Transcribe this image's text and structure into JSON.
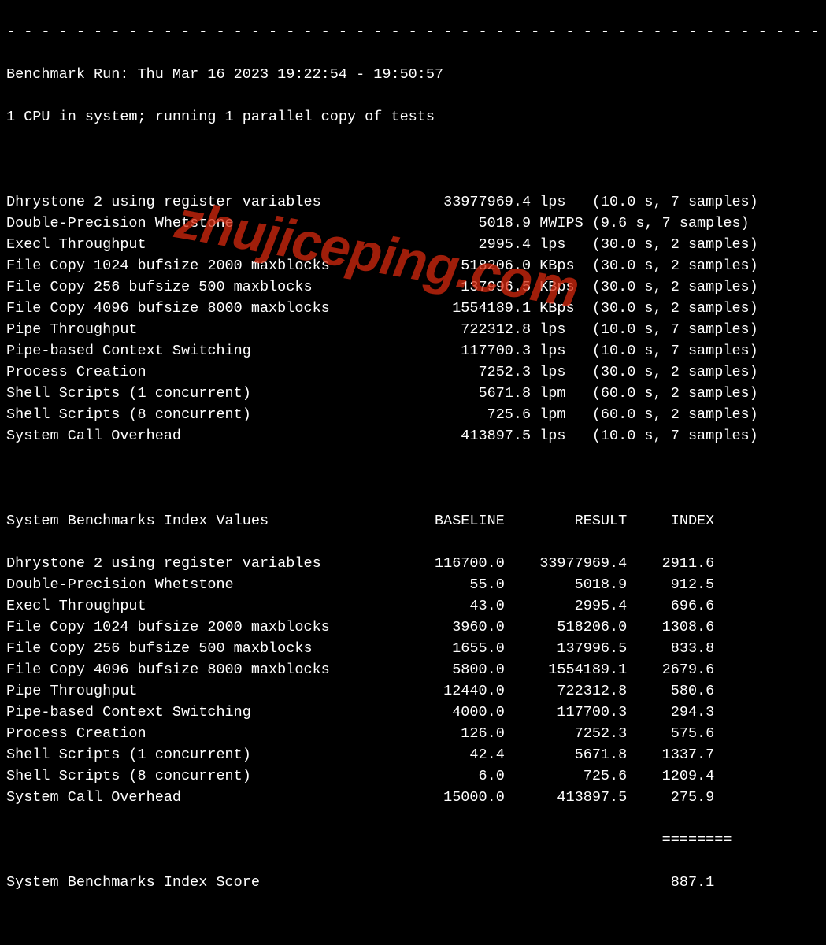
{
  "dashline": "- - - - - - - - - - - - - - - - - - - - - - - - - - - - - - - - - - - - - - - - - - - - - - -",
  "header1": "Benchmark Run: Thu Mar 16 2023 19:22:54 - 19:50:57",
  "header2": "1 CPU in system; running 1 parallel copy of tests",
  "results": [
    {
      "name": "Dhrystone 2 using register variables",
      "value": "33977969.4",
      "unit": "lps",
      "timing": "(10.0 s, 7 samples)"
    },
    {
      "name": "Double-Precision Whetstone",
      "value": "5018.9",
      "unit": "MWIPS",
      "timing": "(9.6 s, 7 samples)"
    },
    {
      "name": "Execl Throughput",
      "value": "2995.4",
      "unit": "lps",
      "timing": "(30.0 s, 2 samples)"
    },
    {
      "name": "File Copy 1024 bufsize 2000 maxblocks",
      "value": "518206.0",
      "unit": "KBps",
      "timing": "(30.0 s, 2 samples)"
    },
    {
      "name": "File Copy 256 bufsize 500 maxblocks",
      "value": "137996.5",
      "unit": "KBps",
      "timing": "(30.0 s, 2 samples)"
    },
    {
      "name": "File Copy 4096 bufsize 8000 maxblocks",
      "value": "1554189.1",
      "unit": "KBps",
      "timing": "(30.0 s, 2 samples)"
    },
    {
      "name": "Pipe Throughput",
      "value": "722312.8",
      "unit": "lps",
      "timing": "(10.0 s, 7 samples)"
    },
    {
      "name": "Pipe-based Context Switching",
      "value": "117700.3",
      "unit": "lps",
      "timing": "(10.0 s, 7 samples)"
    },
    {
      "name": "Process Creation",
      "value": "7252.3",
      "unit": "lps",
      "timing": "(30.0 s, 2 samples)"
    },
    {
      "name": "Shell Scripts (1 concurrent)",
      "value": "5671.8",
      "unit": "lpm",
      "timing": "(60.0 s, 2 samples)"
    },
    {
      "name": "Shell Scripts (8 concurrent)",
      "value": "725.6",
      "unit": "lpm",
      "timing": "(60.0 s, 2 samples)"
    },
    {
      "name": "System Call Overhead",
      "value": "413897.5",
      "unit": "lps",
      "timing": "(10.0 s, 7 samples)"
    }
  ],
  "index_header": {
    "title": "System Benchmarks Index Values",
    "c1": "BASELINE",
    "c2": "RESULT",
    "c3": "INDEX"
  },
  "index_rows": [
    {
      "name": "Dhrystone 2 using register variables",
      "baseline": "116700.0",
      "result": "33977969.4",
      "index": "2911.6"
    },
    {
      "name": "Double-Precision Whetstone",
      "baseline": "55.0",
      "result": "5018.9",
      "index": "912.5"
    },
    {
      "name": "Execl Throughput",
      "baseline": "43.0",
      "result": "2995.4",
      "index": "696.6"
    },
    {
      "name": "File Copy 1024 bufsize 2000 maxblocks",
      "baseline": "3960.0",
      "result": "518206.0",
      "index": "1308.6"
    },
    {
      "name": "File Copy 256 bufsize 500 maxblocks",
      "baseline": "1655.0",
      "result": "137996.5",
      "index": "833.8"
    },
    {
      "name": "File Copy 4096 bufsize 8000 maxblocks",
      "baseline": "5800.0",
      "result": "1554189.1",
      "index": "2679.6"
    },
    {
      "name": "Pipe Throughput",
      "baseline": "12440.0",
      "result": "722312.8",
      "index": "580.6"
    },
    {
      "name": "Pipe-based Context Switching",
      "baseline": "4000.0",
      "result": "117700.3",
      "index": "294.3"
    },
    {
      "name": "Process Creation",
      "baseline": "126.0",
      "result": "7252.3",
      "index": "575.6"
    },
    {
      "name": "Shell Scripts (1 concurrent)",
      "baseline": "42.4",
      "result": "5671.8",
      "index": "1337.7"
    },
    {
      "name": "Shell Scripts (8 concurrent)",
      "baseline": "6.0",
      "result": "725.6",
      "index": "1209.4"
    },
    {
      "name": "System Call Overhead",
      "baseline": "15000.0",
      "result": "413897.5",
      "index": "275.9"
    }
  ],
  "score_divider": "                                                                           ========",
  "score_line": {
    "label": "System Benchmarks Index Score",
    "value": "887.1"
  },
  "watermark": "zhujiceping.com"
}
